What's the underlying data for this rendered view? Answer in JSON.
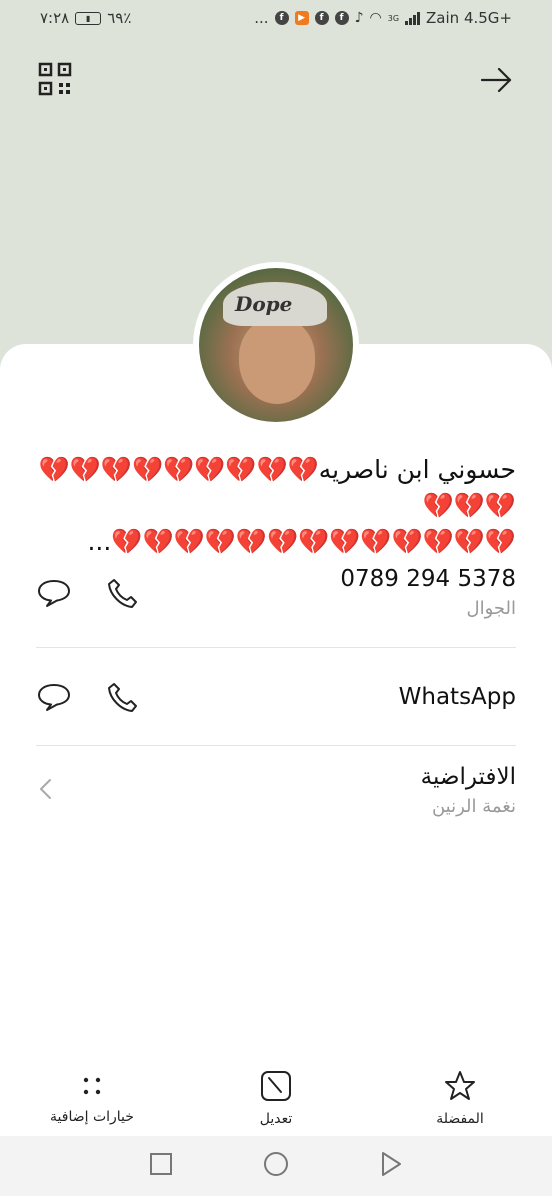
{
  "status_bar": {
    "time": "٧:٢٨",
    "battery": "٦٩٪",
    "carrier": "Zain 4.5G+",
    "network_badge": "3G",
    "more": "..."
  },
  "contact": {
    "name_line1": "حسوني ابن ناصريه💔💔💔💔💔💔💔💔💔💔💔💔",
    "name_line2": "💔💔💔💔💔💔💔💔💔💔💔💔💔...",
    "avatar_cap_text": "Dope",
    "phone_number": "0789 294 5378",
    "phone_type": "الجوال",
    "whatsapp_label": "WhatsApp",
    "ringtone_value": "الافتراضية",
    "ringtone_label": "نغمة الرنين"
  },
  "bottom_actions": {
    "more_options": "خيارات إضافية",
    "edit": "تعديل",
    "favorite": "المفضلة"
  },
  "icons": [
    "qr-code-icon",
    "forward-arrow-icon",
    "message-icon",
    "phone-icon",
    "chevron-left-icon",
    "more-dots-icon",
    "edit-icon",
    "star-icon",
    "recent-apps-icon",
    "home-icon",
    "back-icon"
  ]
}
